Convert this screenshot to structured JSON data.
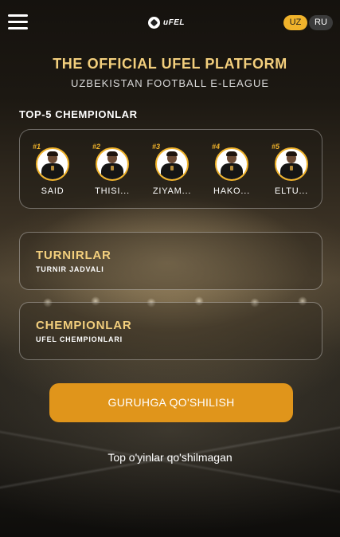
{
  "header": {
    "logo_text": "uFEL",
    "languages": [
      {
        "code": "UZ",
        "active": true
      },
      {
        "code": "RU",
        "active": false
      }
    ]
  },
  "hero": {
    "title": "THE OFFICIAL UFEL PLATFORM",
    "subtitle": "UZBEKISTAN FOOTBALL E-LEAGUE"
  },
  "top_section": {
    "title": "TOP-5 CHEMPIONLAR",
    "players": [
      {
        "rank": "#1",
        "name": "SAID"
      },
      {
        "rank": "#2",
        "name": "THISI..."
      },
      {
        "rank": "#3",
        "name": "ZIYAM..."
      },
      {
        "rank": "#4",
        "name": "HAKO..."
      },
      {
        "rank": "#5",
        "name": "ELTU..."
      }
    ]
  },
  "nav_cards": [
    {
      "title": "TURNIRLAR",
      "subtitle": "TURNIR JADVALI"
    },
    {
      "title": "CHEMPIONLAR",
      "subtitle": "UFEL CHEMPIONLARI"
    }
  ],
  "join_button": {
    "label": "GURUHGA QO'SHILISH"
  },
  "status_text": "Top o'yinlar qo'shilmagan",
  "colors": {
    "accent": "#f0b32b",
    "title_gold": "#f3cf7d",
    "button": "#e0951b"
  }
}
